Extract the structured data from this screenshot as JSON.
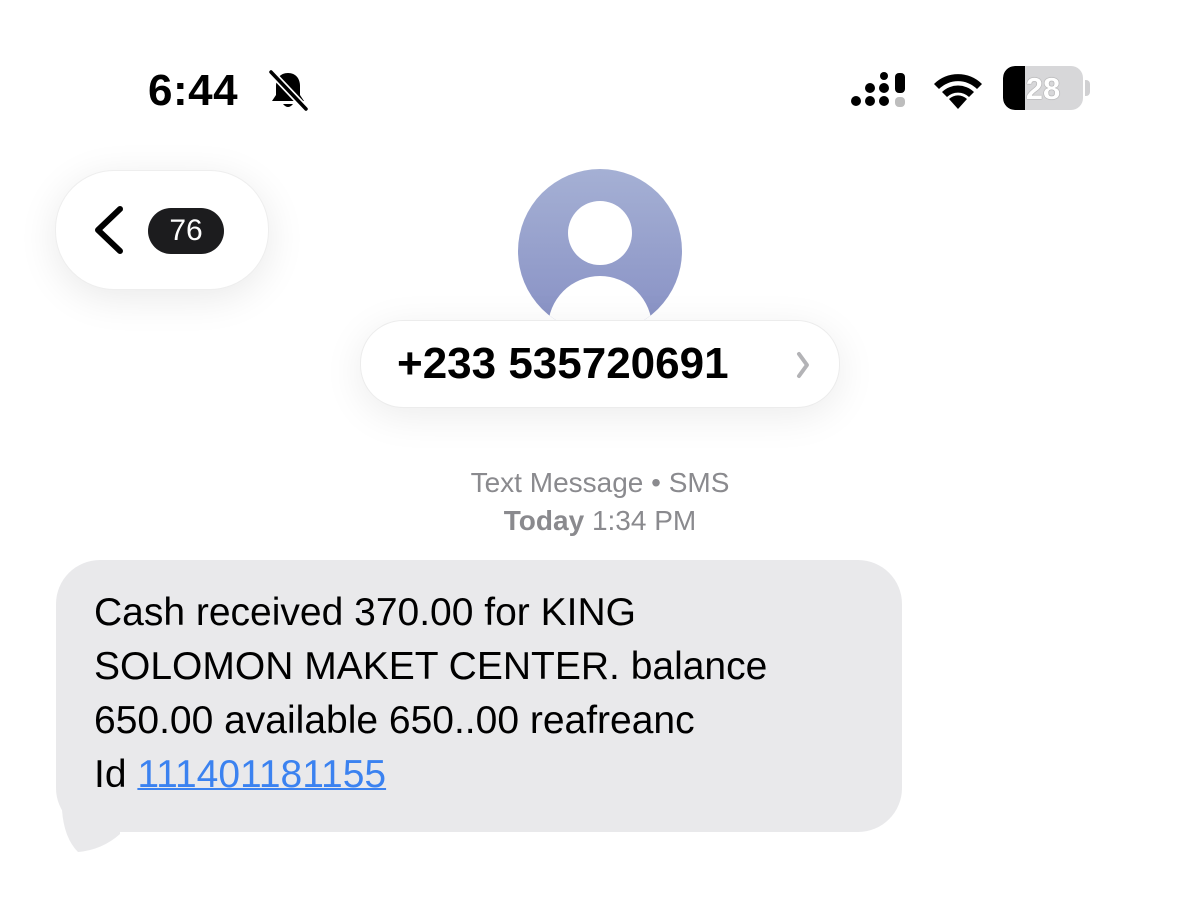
{
  "status_bar": {
    "time": "6:44",
    "battery_level": "28",
    "battery_fraction": 0.28,
    "icons": [
      "bell-slash-icon",
      "cellular-signal-icon",
      "wifi-icon",
      "battery-icon"
    ]
  },
  "nav": {
    "back_icon": "chevron-left-icon",
    "unread_count": "76"
  },
  "contact": {
    "number": "+233 535720691",
    "chevron_icon": "chevron-right-icon",
    "avatar_icon": "person-avatar-icon"
  },
  "conversation": {
    "type_label": "Text Message • SMS",
    "day_label": "Today",
    "time_label": "1:34 PM"
  },
  "messages": [
    {
      "direction": "incoming",
      "lines": [
        "Cash received 370.00 for KING",
        "SOLOMON MAKET CENTER. balance",
        "650.00 available 650..00 reafreanc",
        "Id "
      ],
      "link_text": "111401181155"
    }
  ],
  "colors": {
    "bubble_incoming": "#e9e9eb",
    "link": "#3b82f0",
    "meta_text": "#8a8a8e",
    "avatar_top": "#a5b0d4",
    "avatar_bottom": "#8790c4"
  }
}
